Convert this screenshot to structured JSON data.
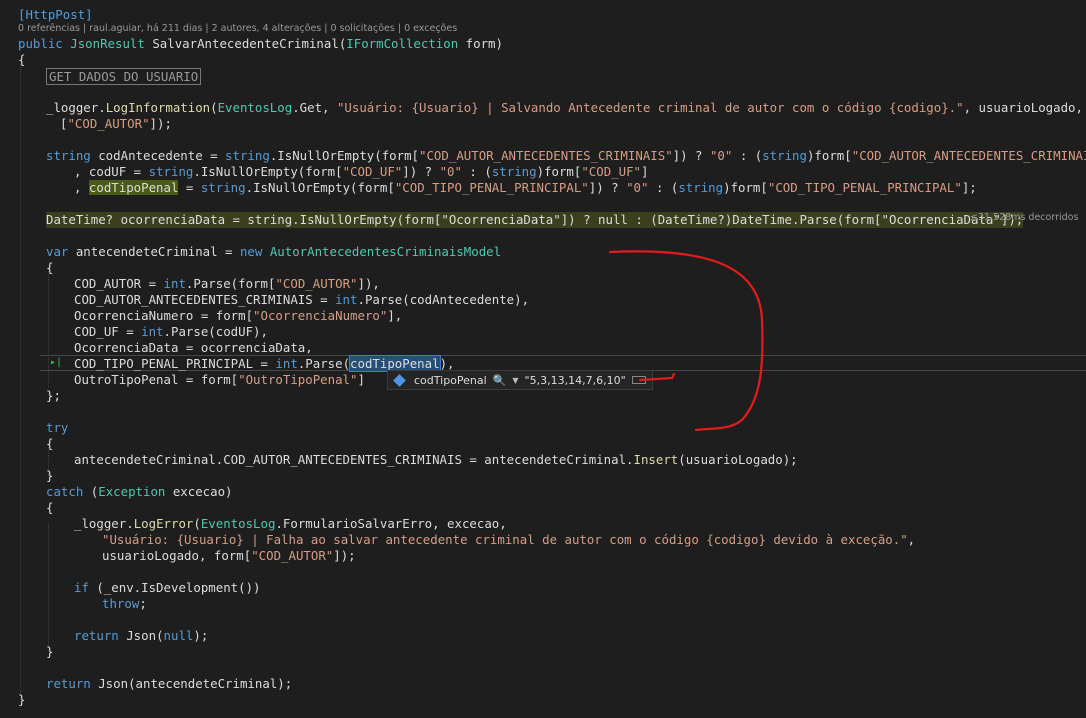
{
  "code": {
    "attribute": "[HttpPost]",
    "codelens": "0 referências | raul.aguiar, há 211 dias | 2 autores, 4 alterações | 0 solicitações | 0 exceções",
    "sig_public": "public",
    "sig_type": "JsonResult",
    "sig_name": "SalvarAntecedenteCriminal",
    "sig_paramtype": "IFormCollection",
    "sig_param": "form)",
    "open_brace": "{",
    "close_brace": "}",
    "region": "GET DADOS DO USUARIO",
    "log1_a": "_logger.",
    "log1_b": "LogInformation",
    "log1_c": "EventosLog",
    "log1_d": ".Get, ",
    "log1_str": "\"Usuário: {Usuario} | Salvando Antecedente criminal de autor com o código {codigo}.\"",
    "log1_e": ", usuarioLogado, form",
    "log1_f": "[",
    "log1_key": "\"COD_AUTOR\"",
    "log1_g": "]);",
    "l1_a": "string",
    "l1_b": " codAntecedente = ",
    "l1_c": "string",
    "l1_d": ".IsNullOrEmpty(form[",
    "l1_key": "\"COD_AUTOR_ANTECEDENTES_CRIMINAIS\"",
    "l1_e": "]) ? ",
    "l1_zero": "\"0\"",
    "l1_f": " : (",
    "l1_g": "string",
    "l1_h": ")form[",
    "l1_key2": "\"COD_AUTOR_ANTECEDENTES_CRIMINAIS\"",
    "l1_i": "]",
    "l2_a": ", codUF = ",
    "l2_b": "string",
    "l2_c": ".IsNullOrEmpty(form[",
    "l2_key": "\"COD_UF\"",
    "l2_d": "]) ? ",
    "l2_zero": "\"0\"",
    "l2_e": " : (",
    "l2_f": "string",
    "l2_g": ")form[",
    "l2_key2": "\"COD_UF\"",
    "l2_h": "]",
    "l3_a": ", ",
    "l3_tok": "codTipoPenal",
    "l3_b": " = ",
    "l3_c": "string",
    "l3_d": ".IsNullOrEmpty(form[",
    "l3_key": "\"COD_TIPO_PENAL_PRINCIPAL\"",
    "l3_e": "]) ? ",
    "l3_zero": "\"0\"",
    "l3_f": " : (",
    "l3_g": "string",
    "l3_h": ")form[",
    "l3_key2": "\"COD_TIPO_PENAL_PRINCIPAL\"",
    "l3_i": "];",
    "dt_line": "DateTime? ocorrenciaData = string.IsNullOrEmpty(form[\"OcorrenciaData\"]) ? null : (DateTime?)DateTime.Parse(form[\"OcorrenciaData\"]);",
    "elapsed": "≤31.528ms decorridos",
    "var_kw": "var",
    "var_a": " antecendeteCriminal = ",
    "var_new": "new",
    "var_type": "AutorAntecedentesCriminaisModel",
    "m1_a": "COD_AUTOR = ",
    "m1_int": "int",
    "m1_b": ".Parse(form[",
    "m1_key": "\"COD_AUTOR\"",
    "m1_c": "]),",
    "m2_a": "COD_AUTOR_ANTECEDENTES_CRIMINAIS = ",
    "m2_int": "int",
    "m2_b": ".Parse(codAntecedente),",
    "m3_a": "OcorrenciaNumero = form[",
    "m3_key": "\"OcorrenciaNumero\"",
    "m3_b": "],",
    "m4_a": "COD_UF = ",
    "m4_int": "int",
    "m4_b": ".Parse(codUF),",
    "m5_a": "OcorrenciaData = ocorrenciaData,",
    "m6_a": "COD_TIPO_PENAL_PRINCIPAL = ",
    "m6_int": "int",
    "m6_b": ".Parse(",
    "m6_sel": "codTipoPenal",
    "m6_c": "),",
    "m7_a": "OutroTipoPenal = form[",
    "m7_key": "\"OutroTipoPenal\"",
    "m7_b": "]",
    "close_init": "};",
    "try_kw": "try",
    "ins_a": "antecendeteCriminal.COD_AUTOR_ANTECEDENTES_CRIMINAIS = antecendeteCriminal.",
    "ins_m": "Insert",
    "ins_b": "(usuarioLogado);",
    "catch_kw": "catch",
    "catch_a": " (",
    "catch_type": "Exception",
    "catch_b": " excecao)",
    "err_a": "_logger.",
    "err_m": "LogError",
    "err_b": "(",
    "err_c": "EventosLog",
    "err_d": ".FormularioSalvarErro, excecao,",
    "err_str": "\"Usuário: {Usuario} | Falha ao salvar antecedente criminal de autor com o código {codigo} devido à exceção.\"",
    "err_e": ",",
    "err_f": "usuarioLogado, form[",
    "err_key": "\"COD_AUTOR\"",
    "err_g": "]);",
    "if_kw": "if",
    "if_a": " (_env.IsDevelopment())",
    "throw_kw": "throw",
    "throw_a": ";",
    "ret_kw": "return",
    "ret_a": " Json(",
    "ret_null": "null",
    "ret_b": ");",
    "ret2_kw": "return",
    "ret2_a": " Json(antecendeteCriminal);"
  },
  "tooltip": {
    "name": "codTipoPenal",
    "value": "\"5,3,13,14,7,6,10\"",
    "icon": "variable-icon"
  },
  "colors": {
    "background": "#1e1e1e",
    "keyword": "#569cd6",
    "type": "#4ec9b0",
    "string": "#d69d85",
    "annotation": "#e51b1b"
  }
}
